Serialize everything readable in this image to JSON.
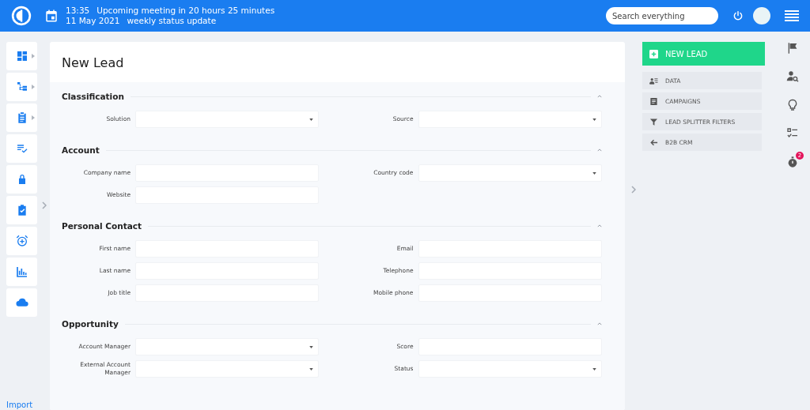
{
  "header": {
    "time": "13:35",
    "meeting": "Upcoming meeting in 20 hours 25 minutes",
    "date": "11 May 2021",
    "event": "weekly status update",
    "search": {
      "placeholder": "Search everything"
    }
  },
  "sidebar": {
    "items": [
      {
        "submenu": true
      },
      {
        "submenu": true
      },
      {
        "submenu": true
      },
      {
        "submenu": false
      },
      {
        "submenu": false
      },
      {
        "submenu": false
      },
      {
        "submenu": false
      },
      {
        "submenu": false
      },
      {
        "submenu": false
      }
    ],
    "import_link": "Import"
  },
  "page": {
    "title": "New Lead",
    "sections": [
      {
        "title": "Classification",
        "fields": [
          {
            "label": "Solution",
            "kind": "select"
          },
          {
            "label": "Source",
            "kind": "select"
          }
        ]
      },
      {
        "title": "Account",
        "fields": [
          {
            "label": "Company name",
            "kind": "text"
          },
          {
            "label": "Country code",
            "kind": "select"
          },
          {
            "label": "Website",
            "kind": "text"
          }
        ]
      },
      {
        "title": "Personal Contact",
        "fields": [
          {
            "label": "First name",
            "kind": "text"
          },
          {
            "label": "Email",
            "kind": "text"
          },
          {
            "label": "Last name",
            "kind": "text"
          },
          {
            "label": "Telephone",
            "kind": "text"
          },
          {
            "label": "Job title",
            "kind": "text"
          },
          {
            "label": "Mobile phone",
            "kind": "text"
          }
        ]
      },
      {
        "title": "Opportunity",
        "fields": [
          {
            "label": "Account Manager",
            "kind": "select"
          },
          {
            "label": "Score",
            "kind": "text"
          },
          {
            "label": "External Account Manager",
            "kind": "select"
          },
          {
            "label": "Status",
            "kind": "select"
          }
        ]
      }
    ]
  },
  "actions": {
    "primary": "NEW LEAD",
    "items": [
      {
        "label": "DATA"
      },
      {
        "label": "CAMPAIGNS"
      },
      {
        "label": "LEAD SPLITTER FILTERS"
      },
      {
        "label": "B2B CRM"
      }
    ]
  },
  "rail": {
    "badge": "2"
  }
}
